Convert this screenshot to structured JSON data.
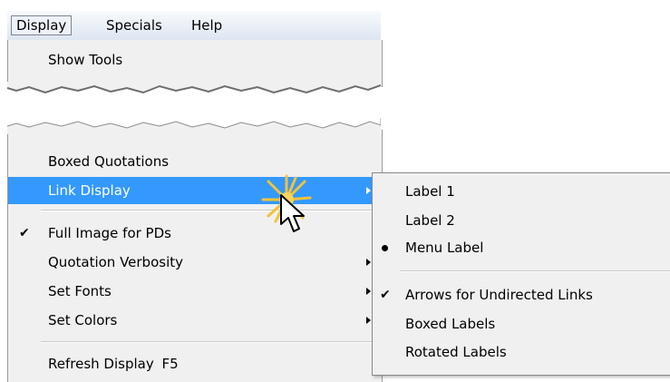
{
  "menubar": {
    "items": [
      {
        "label": "Display"
      },
      {
        "label": "Specials"
      },
      {
        "label": "Help"
      }
    ]
  },
  "top_dropdown": {
    "items": [
      {
        "label": "Show Tools"
      }
    ]
  },
  "display_menu": {
    "items": [
      {
        "label": "Boxed Quotations"
      },
      {
        "label": "Link Display",
        "submenu": true,
        "highlighted": true
      },
      {
        "label": "Full Image for PDs",
        "checked": true
      },
      {
        "label": "Quotation Verbosity",
        "submenu": true
      },
      {
        "label": "Set Fonts",
        "submenu": true
      },
      {
        "label": "Set Colors",
        "submenu": true
      },
      {
        "label": "Refresh Display",
        "shortcut": "F5"
      }
    ]
  },
  "link_display_submenu": {
    "items": [
      {
        "label": "Label 1"
      },
      {
        "label": "Label 2"
      },
      {
        "label": "Menu Label",
        "selected": true
      },
      {
        "label": "Arrows for Undirected Links",
        "checked": true
      },
      {
        "label": "Boxed Labels"
      },
      {
        "label": "Rotated Labels"
      }
    ]
  },
  "colors": {
    "highlight": "#3399ff",
    "menu_background": "#f0f0f0",
    "click_burst": "#f2c23a"
  },
  "icons": {
    "check": "checkmark-icon",
    "radio": "radio-dot-icon",
    "submenu": "submenu-arrow-icon",
    "cursor": "mouse-pointer-icon",
    "click": "click-burst-icon"
  }
}
